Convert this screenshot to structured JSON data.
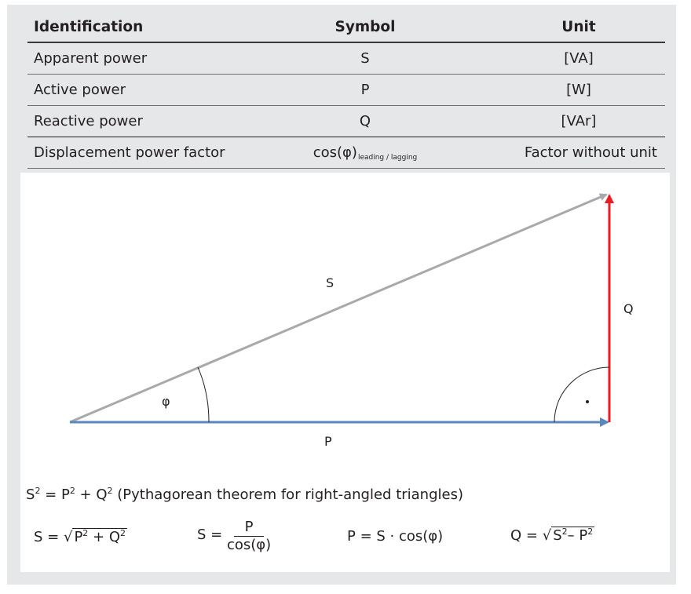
{
  "table": {
    "headers": [
      "Identification",
      "Symbol",
      "Unit"
    ],
    "rows": [
      {
        "identification": "Apparent power",
        "symbol": "S",
        "unit": "[VA]"
      },
      {
        "identification": "Active power",
        "symbol": "P",
        "unit": "[W]"
      },
      {
        "identification": "Reactive power",
        "symbol": "Q",
        "unit": "[VAr]"
      },
      {
        "identification": "Displacement power factor",
        "symbol": "cos(φ)",
        "symbol_subscript": "leading / lagging",
        "unit": "Factor without unit"
      }
    ]
  },
  "diagram": {
    "vectors": [
      {
        "name": "S",
        "label": "S",
        "meaning": "apparent power (hypotenuse)",
        "color": "#a7a9ac"
      },
      {
        "name": "P",
        "label": "P",
        "meaning": "active power (horizontal)",
        "color": "#5b87c0"
      },
      {
        "name": "Q",
        "label": "Q",
        "meaning": "reactive power (vertical)",
        "color": "#ed1c24"
      }
    ],
    "angle_label": "φ",
    "right_angle_marker": "·"
  },
  "formulas": {
    "pythagoras": {
      "lhs": "S",
      "lhs_exp": "2",
      "eq": " = ",
      "p": "P",
      "p_exp": "2",
      "plus": " + ",
      "q": "Q",
      "q_exp": "2",
      "note": " (Pythagorean theorem for right-angled triangles)"
    },
    "s_sqrt": {
      "lhs": "S = ",
      "root": "√",
      "p": "P",
      "p_exp": "2",
      "plus": " + ",
      "q": "Q",
      "q_exp": "2"
    },
    "s_frac": {
      "lhs": "S = ",
      "num": "P",
      "den": "cos(φ)"
    },
    "p_eq": {
      "text": "P = S · cos(φ)"
    },
    "q_sqrt": {
      "lhs": "Q = ",
      "root": "√",
      "s": "S",
      "s_exp": "2",
      "minus": "– ",
      "p": "P",
      "p_exp": "2"
    }
  }
}
